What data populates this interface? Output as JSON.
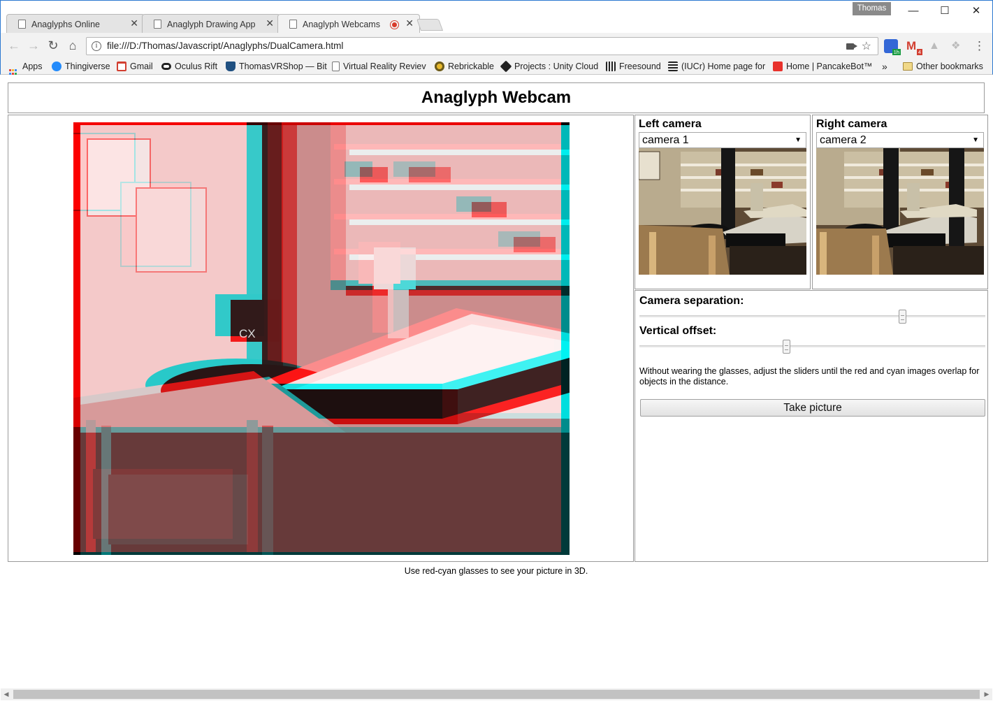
{
  "window": {
    "user": "Thomas",
    "controls": {
      "minimize": "—",
      "maximize": "☐",
      "close": "✕"
    }
  },
  "tabs": [
    {
      "label": "Anaglyphs Online",
      "close": "✕"
    },
    {
      "label": "Anaglyph Drawing App",
      "close": "✕"
    },
    {
      "label": "Anaglyph Webcams",
      "close": "✕"
    }
  ],
  "toolbar": {
    "back": "←",
    "forward": "→",
    "reload": "↻",
    "home": "⌂",
    "info": "i",
    "url": "file:///D:/Thomas/Javascript/Anaglyphs/DualCamera.html",
    "star": "☆",
    "chat_badge": "1h",
    "gmail": "M",
    "gmail_badge": "4",
    "drive": "▲",
    "dropbox": "❖",
    "menu": "⋮"
  },
  "bookmarks": {
    "items": [
      {
        "label": "Apps",
        "icon": "apps-grid-icon"
      },
      {
        "label": "Thingiverse",
        "icon": "thingiverse-icon",
        "color": "#248bfb"
      },
      {
        "label": "Gmail",
        "icon": "gmail-icon",
        "color": "#d23f31"
      },
      {
        "label": "Oculus Rift",
        "icon": "oculus-icon",
        "color": "#222222"
      },
      {
        "label": "ThomasVRShop — Bit",
        "icon": "bitbucket-icon",
        "color": "#205081"
      },
      {
        "label": "Virtual Reality Reviev",
        "icon": "page-icon",
        "color": "#ffffff"
      },
      {
        "label": "Rebrickable",
        "icon": "rebrickable-icon",
        "color": "#6b5a1c"
      },
      {
        "label": "Projects : Unity Cloud",
        "icon": "unity-icon",
        "color": "#222222"
      },
      {
        "label": "Freesound",
        "icon": "freesound-icon",
        "color": "#222222"
      },
      {
        "label": "(IUCr) Home page for",
        "icon": "iucr-icon",
        "color": "#222222"
      },
      {
        "label": "Home | PancakeBot™",
        "icon": "pancakebot-icon",
        "color": "#e8322c"
      }
    ],
    "overflow": "»",
    "other": "Other bookmarks"
  },
  "page": {
    "title": "Anaglyph Webcam",
    "left_camera": {
      "title": "Left camera",
      "selected": "camera 1"
    },
    "right_camera": {
      "title": "Right camera",
      "selected": "camera 2"
    },
    "separation": {
      "label": "Camera separation:",
      "value": 0.76
    },
    "vertical": {
      "label": "Vertical offset:",
      "value": 0.425
    },
    "hint": "Without wearing the glasses, adjust the sliders until the red and cyan images overlap for objects in the distance.",
    "take_picture": "Take picture",
    "footer": "Use red-cyan glasses to see your picture in 3D."
  }
}
